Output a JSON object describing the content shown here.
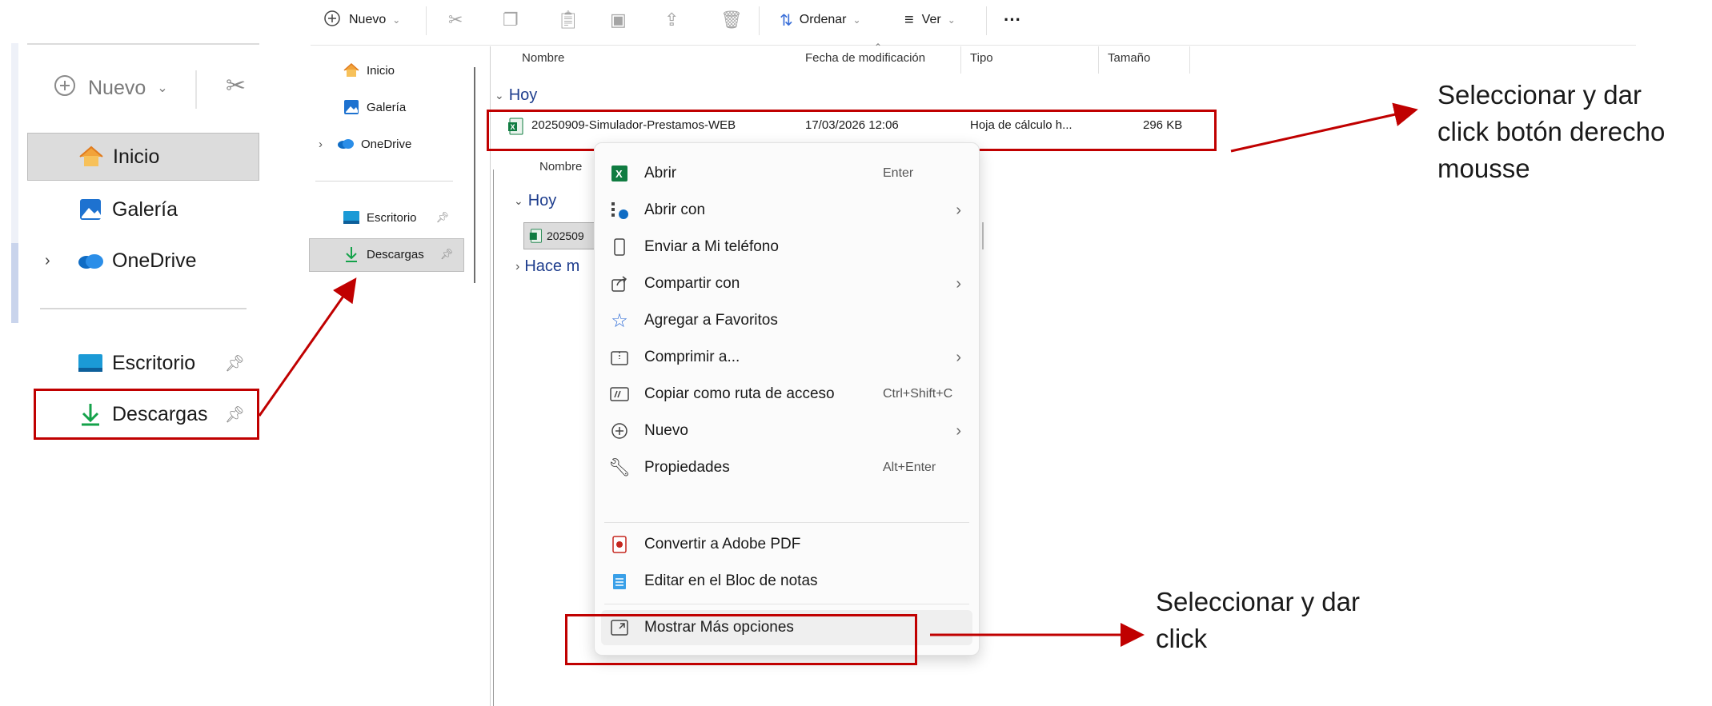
{
  "zoom_panel": {
    "new_label": "Nuevo",
    "items": [
      {
        "label": "Inicio"
      },
      {
        "label": "Galería"
      },
      {
        "label": "OneDrive"
      },
      {
        "label": "Escritorio"
      },
      {
        "label": "Descargas"
      }
    ]
  },
  "toolbar": {
    "new_label": "Nuevo",
    "sort_label": "Ordenar",
    "view_label": "Ver",
    "more_label": "···"
  },
  "nav": {
    "items": [
      {
        "label": "Inicio"
      },
      {
        "label": "Galería"
      },
      {
        "label": "OneDrive"
      },
      {
        "label": "Escritorio"
      },
      {
        "label": "Descargas"
      }
    ]
  },
  "columns": {
    "name": "Nombre",
    "modified": "Fecha de modificación",
    "type": "Tipo",
    "size": "Tamaño"
  },
  "group_today": "Hoy",
  "file": {
    "name": "20250909-Simulador-Prestamos-WEB",
    "modified": "17/03/2026 12:06",
    "type": "Hoja de cálculo h...",
    "size": "296 KB"
  },
  "behind": {
    "col_name": "Nombre",
    "col_name2": "nombre",
    "group_today": "Hoy",
    "file_partial": "202509",
    "group_older": "Hace m"
  },
  "context_menu": {
    "items": [
      {
        "label": "Abrir",
        "shortcut": "Enter"
      },
      {
        "label": "Abrir con"
      },
      {
        "label": "Enviar a Mi teléfono"
      },
      {
        "label": "Compartir con"
      },
      {
        "label": "Agregar a Favoritos"
      },
      {
        "label": "Comprimir a..."
      },
      {
        "label": "Copiar como ruta de acceso",
        "shortcut": "Ctrl+Shift+C"
      },
      {
        "label": "Nuevo"
      },
      {
        "label": "Propiedades",
        "shortcut": "Alt+Enter"
      },
      {
        "label": "Convertir a Adobe PDF"
      },
      {
        "label": "Editar en el Bloc de notas"
      },
      {
        "label": "Mostrar Más opciones"
      }
    ]
  },
  "annotations": {
    "top_right": [
      "Seleccionar y dar",
      "click botón derecho",
      "mousse"
    ],
    "bottom_right": [
      "Seleccionar y dar",
      "click"
    ]
  },
  "colors": {
    "annotation_red": "#c00000",
    "selection_gray": "#dcdcdc",
    "group_blue": "#1f3e8e"
  }
}
